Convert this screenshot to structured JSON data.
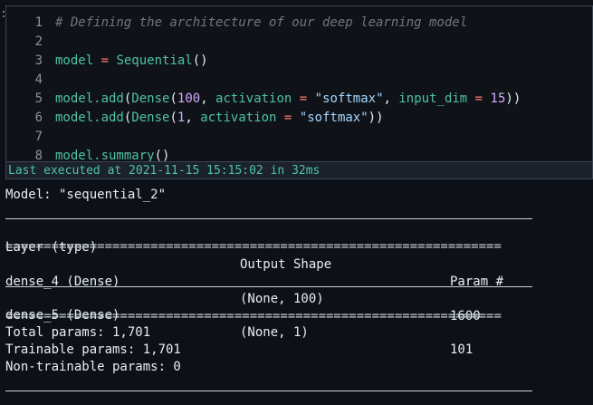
{
  "cell": {
    "prompt": ":",
    "lines": [
      {
        "n": "1",
        "text": "# Defining the architecture of our deep learning model"
      },
      {
        "n": "2",
        "text": ""
      },
      {
        "n": "3",
        "text": "model = Sequential()"
      },
      {
        "n": "4",
        "text": ""
      },
      {
        "n": "5",
        "text": "model.add(Dense(100, activation = \"softmax\", input_dim = 15))"
      },
      {
        "n": "6",
        "text": "model.add(Dense(1, activation = \"softmax\"))"
      },
      {
        "n": "7",
        "text": ""
      },
      {
        "n": "8",
        "text": "model.summary()"
      }
    ],
    "status": "Last executed at 2021-11-15 15:15:02 in 32ms"
  },
  "output": {
    "model_line": "Model: \"sequential_2\"",
    "headers": [
      "Layer (type)",
      "Output Shape",
      "Param #"
    ],
    "rows": [
      {
        "layer": "dense_4 (Dense)",
        "shape": "(None, 100)",
        "params": "1600"
      },
      {
        "layer": "dense_5 (Dense)",
        "shape": "(None, 1)",
        "params": "101"
      }
    ],
    "double_rule": "=================================================================",
    "total": "Total params: 1,701",
    "trainable": "Trainable params: 1,701",
    "non_trainable": "Non-trainable params: 0"
  }
}
